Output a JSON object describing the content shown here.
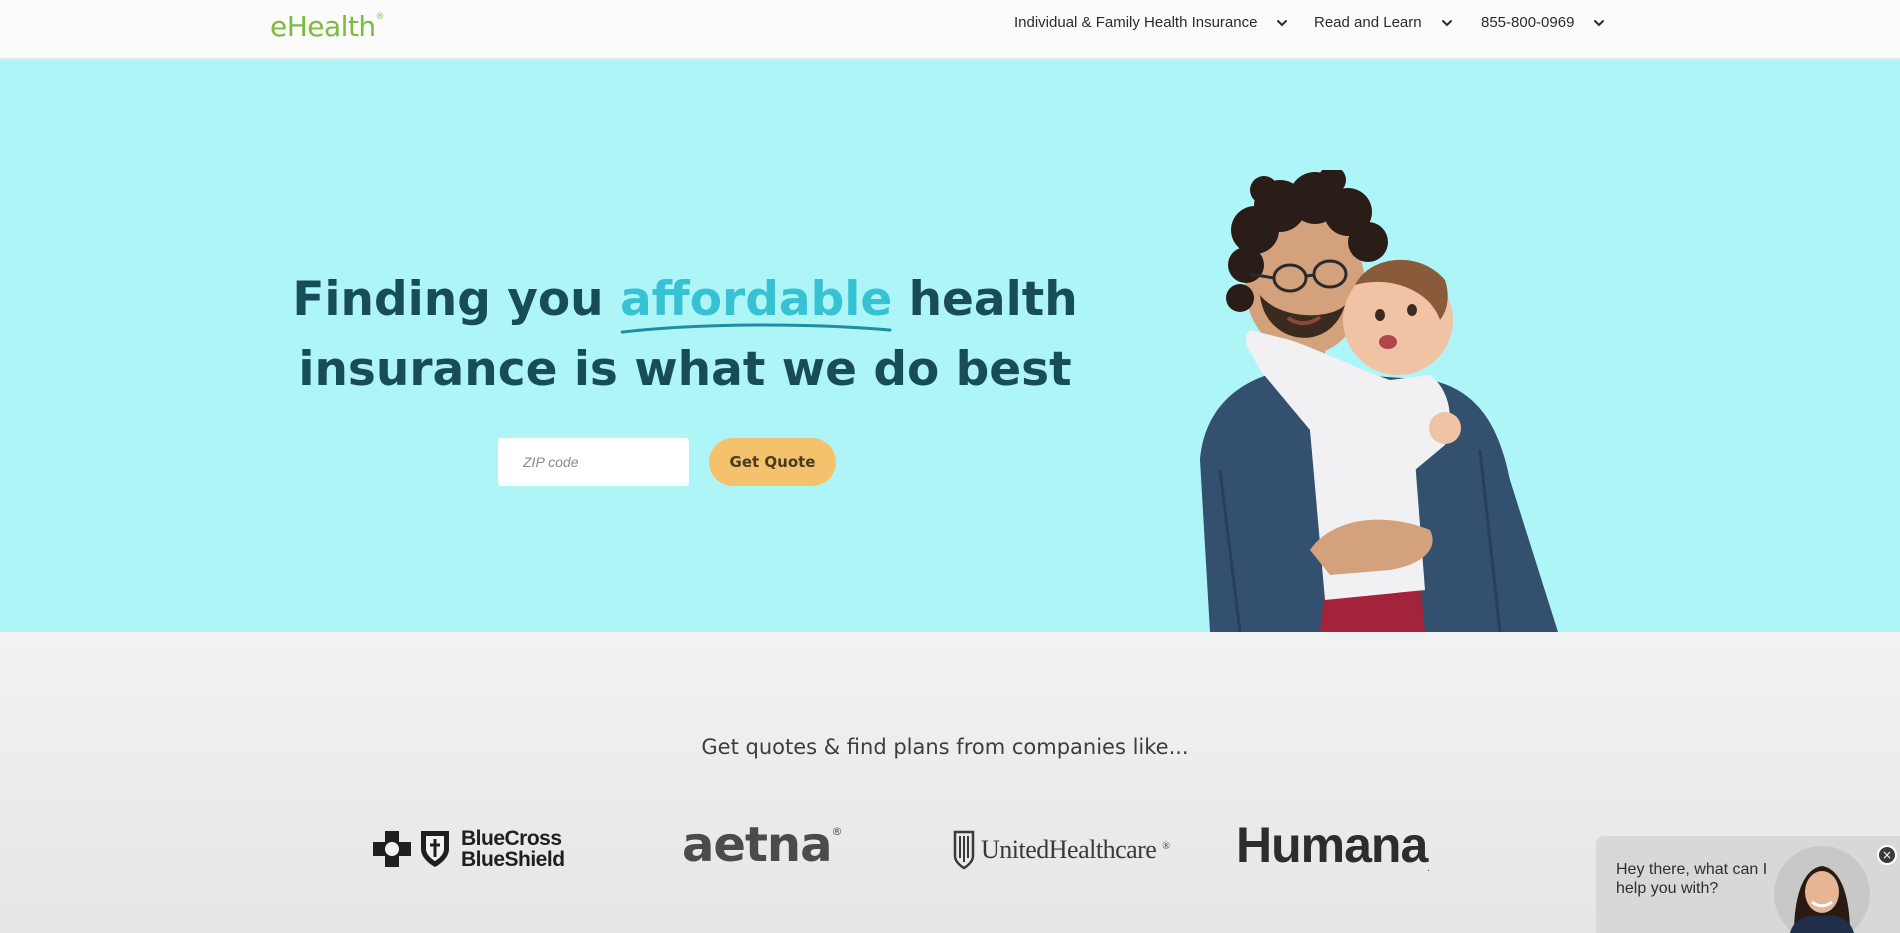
{
  "header": {
    "logo": "eHealth",
    "logo_mark": "®",
    "nav": [
      {
        "label": "Individual & Family Health Insurance",
        "icon": "chevron-down-icon"
      },
      {
        "label": "Read and Learn",
        "icon": "chevron-down-icon"
      },
      {
        "label": "855-800-0969",
        "icon": "chevron-down-icon"
      }
    ]
  },
  "hero": {
    "headline_before": "Finding you ",
    "headline_accent": "affordable",
    "headline_after_line1": " health",
    "headline_line2": "insurance is what we do best",
    "zip_placeholder": "ZIP code",
    "cta_label": "Get Quote",
    "image": "father-holding-baby-photo"
  },
  "companies": {
    "title": "Get quotes & find plans from companies like...",
    "logos": [
      {
        "line1": "BlueCross",
        "line2": "BlueShield"
      },
      {
        "text": "aetna",
        "mark": "®"
      },
      {
        "text": "UnitedHealthcare",
        "mark": "®"
      },
      {
        "text": "Humana",
        "mark": "."
      }
    ]
  },
  "chat": {
    "message": "Hey there, what can I help you with?",
    "close": "×"
  },
  "colors": {
    "brand_green": "#7dbb3f",
    "hero_bg": "#aef5f8",
    "headline": "#174c58",
    "accent": "#37c2d3",
    "cta": "#f4c26c"
  }
}
